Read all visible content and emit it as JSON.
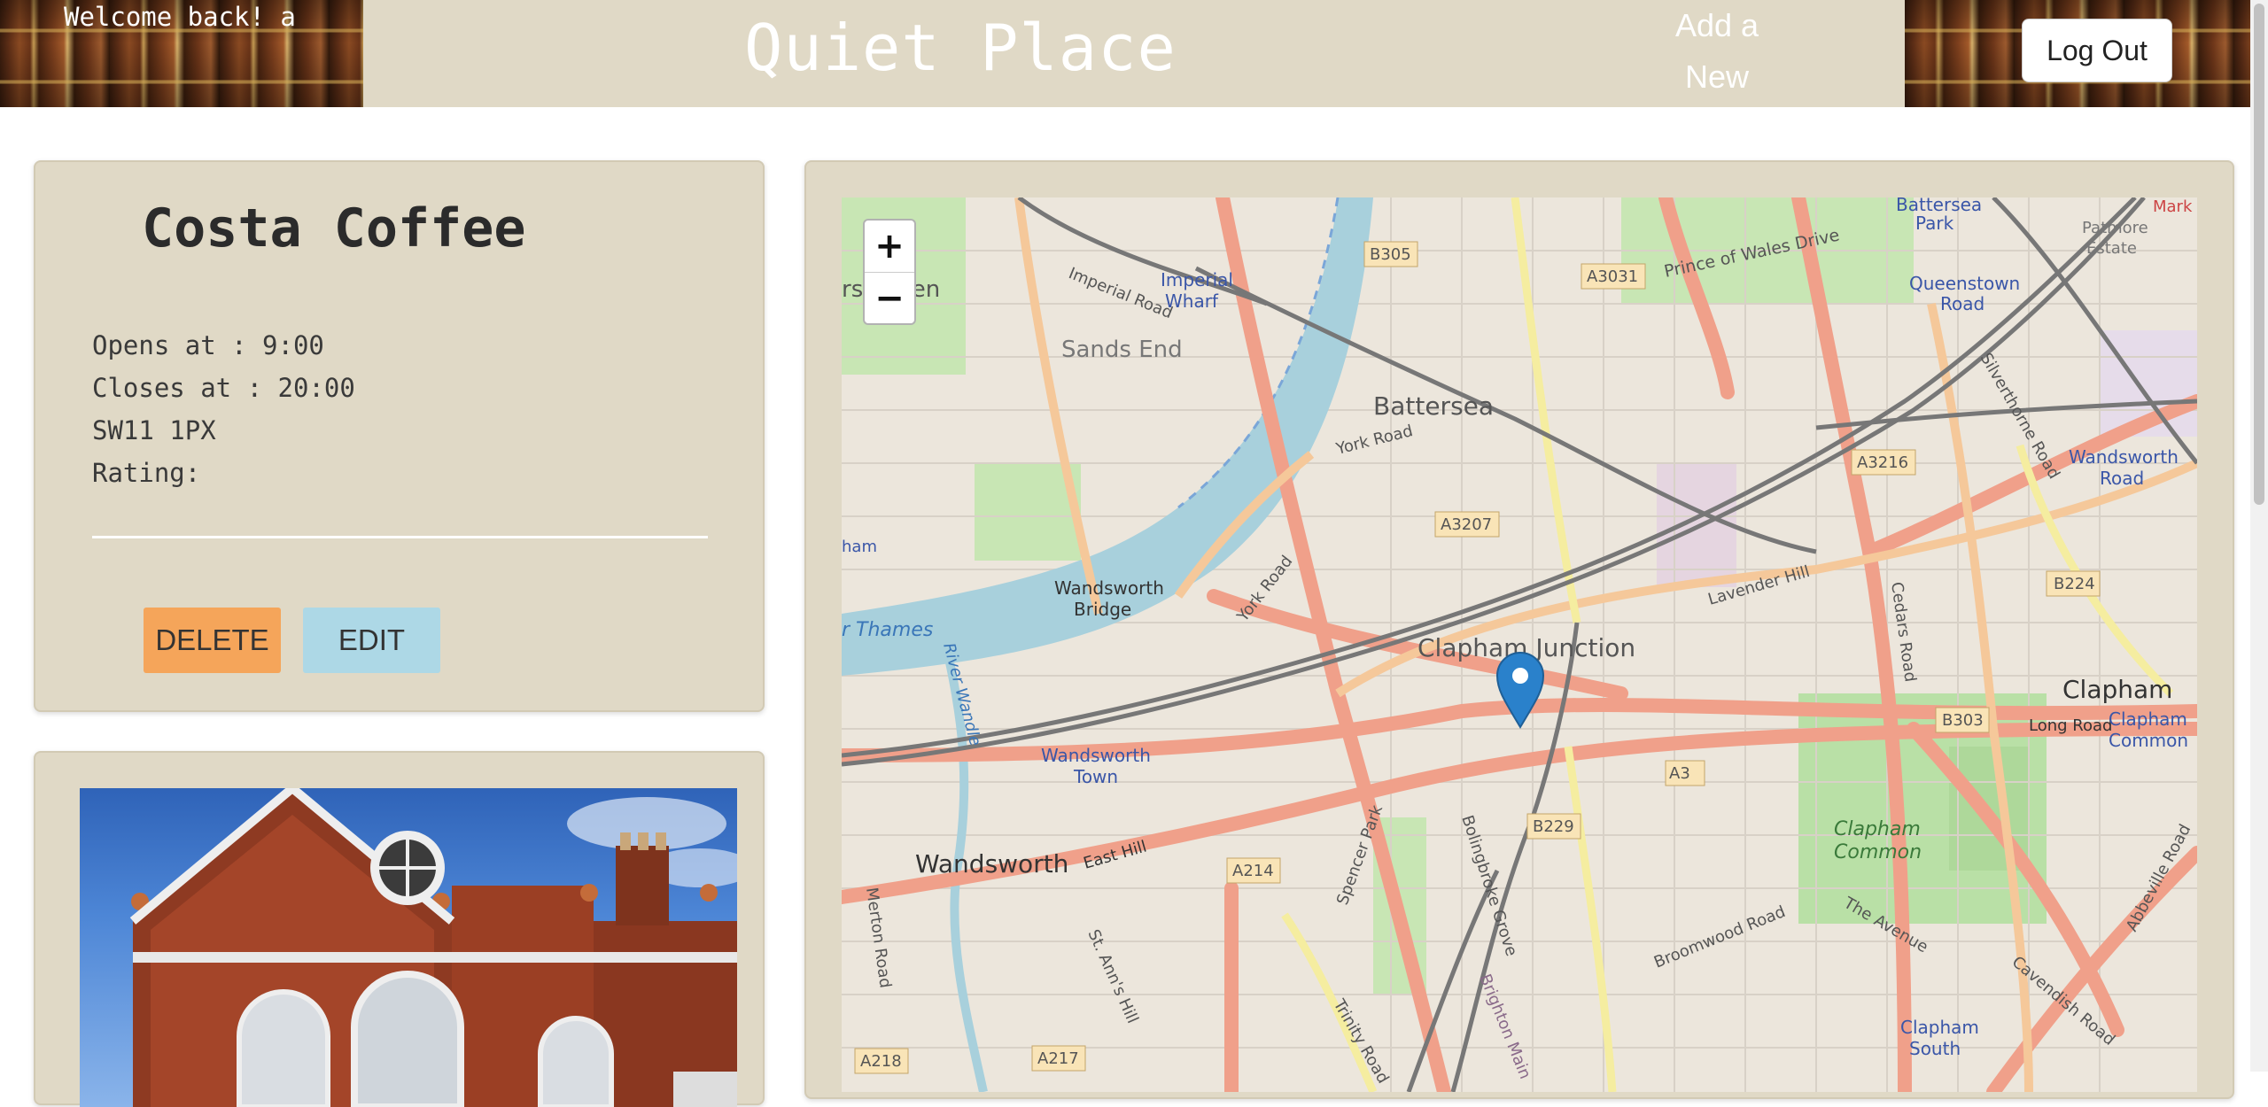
{
  "header": {
    "welcome": "Welcome back! a",
    "title": "Quiet Place",
    "add_new_line1": "Add a",
    "add_new_line2": "New",
    "logout": "Log Out"
  },
  "place": {
    "name": "Costa Coffee",
    "opens": "Opens at : 9:00",
    "closes": "Closes at : 20:00",
    "postcode": "SW11 1PX",
    "rating": "Rating:",
    "delete_label": "DELETE",
    "edit_label": "EDIT"
  },
  "map": {
    "zoom_in": "+",
    "zoom_out": "−",
    "labels": {
      "green": "rs Green",
      "imperial_road": "Imperial Road",
      "imperial_wharf": "Imperial",
      "imperial_wharf2": "Wharf",
      "sands_end": "Sands End",
      "b305": "B305",
      "a3031": "A3031",
      "prince_of_wales": "Prince of Wales Drive",
      "battersea_park": "Battersea",
      "battersea_park2": "Park",
      "patmore": "Patmore",
      "patmore2": "Estate",
      "queenstown": "Queenstown",
      "queenstown2": "Road",
      "battersea": "Battersea",
      "york_road": "York Road",
      "a3207": "A3207",
      "a3216": "A3216",
      "wandsworth_road": "Wandsworth",
      "wandsworth_road2": "Road",
      "ham": "ham",
      "wandsworth_bridge": "Wandsworth",
      "wandsworth_bridge2": "Bridge",
      "lavender_hill": "Lavender Hill",
      "b224": "B224",
      "thames": "r Thames",
      "clapham_junction": "Clapham Junction",
      "clapham": "Clapham",
      "b303": "B303",
      "long_road": "Long Road",
      "clapham_common_stn": "Clapham",
      "clapham_common_stn2": "Common",
      "wandsworth_town": "Wandsworth",
      "wandsworth_town2": "Town",
      "a3": "A3",
      "b229": "B229",
      "clapham_common": "Clapham",
      "clapham_common2": "Common",
      "wandsworth": "Wandsworth",
      "east_hill": "East Hill",
      "a214": "A214",
      "merton_road": "Merton Road",
      "st_anns_hill": "St. Ann's Hill",
      "broomwood": "Broomwood Road",
      "the_avenue": "The Avenue",
      "cavendish": "Cavendish Road",
      "abbeville": "Abbeville Road",
      "clapham_south": "Clapham",
      "clapham_south2": "South",
      "a218": "A218",
      "a217": "A217",
      "bolingbroke": "Bolingbroke Grove",
      "cedars_road": "Cedars Road",
      "york_road2": "York Road",
      "river_wandle": "River Wandle",
      "mark": "Mark",
      "silverthorne": "Silverthorne Road",
      "spencer_park": "Spencer Park",
      "trinity_road": "Trinity Road",
      "brighton_main": "Brighton Main"
    }
  },
  "colors": {
    "header_bg": "#e0d9c6",
    "card_bg": "#e0d9c6",
    "delete": "#f5a55a",
    "edit": "#add8e6",
    "river": "#a8d0dc",
    "road_major": "#f0a08a",
    "marker": "#2a81cb"
  }
}
